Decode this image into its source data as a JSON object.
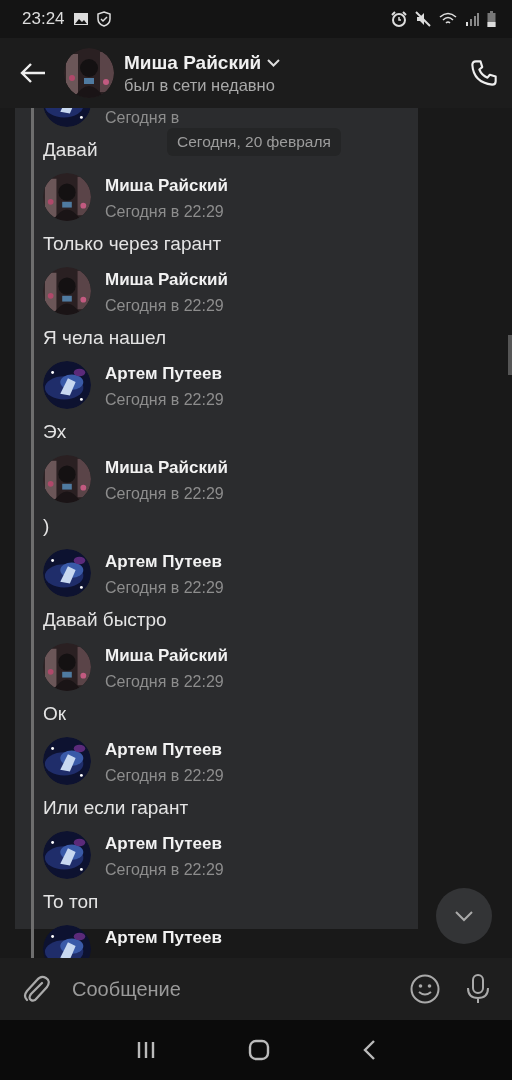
{
  "status_bar": {
    "time": "23:24"
  },
  "header": {
    "name": "Миша Райский",
    "status": "был в сети недавно",
    "kind": "warm"
  },
  "date_pill": "Сегодня, 20 февраля",
  "messages": [
    {
      "time": "Сегодня в",
      "text": "Давай",
      "kind": "space"
    },
    {
      "author": "Миша Райский",
      "time": "Сегодня в 22:29",
      "text": "Только через гарант",
      "kind": "warm"
    },
    {
      "author": "Миша Райский",
      "time": "Сегодня в 22:29",
      "text": "Я чела нашел",
      "kind": "warm"
    },
    {
      "author": "Артем Путеев",
      "time": "Сегодня в 22:29",
      "text": "Эх",
      "kind": "space"
    },
    {
      "author": "Миша Райский",
      "time": "Сегодня в 22:29",
      "text": ")",
      "kind": "warm"
    },
    {
      "author": "Артем Путеев",
      "time": "Сегодня в 22:29",
      "text": "Давай быстро",
      "kind": "space"
    },
    {
      "author": "Миша Райский",
      "time": "Сегодня в 22:29",
      "text": "Ок",
      "kind": "warm"
    },
    {
      "author": "Артем Путеев",
      "time": "Сегодня в 22:29",
      "text": "Или если гарант",
      "kind": "space"
    },
    {
      "author": "Артем Путеев",
      "time": "Сегодня в 22:29",
      "text": "То топ",
      "kind": "space"
    },
    {
      "author": "Артем Путеев",
      "kind": "space"
    }
  ],
  "composer": {
    "placeholder": "Сообщение"
  }
}
